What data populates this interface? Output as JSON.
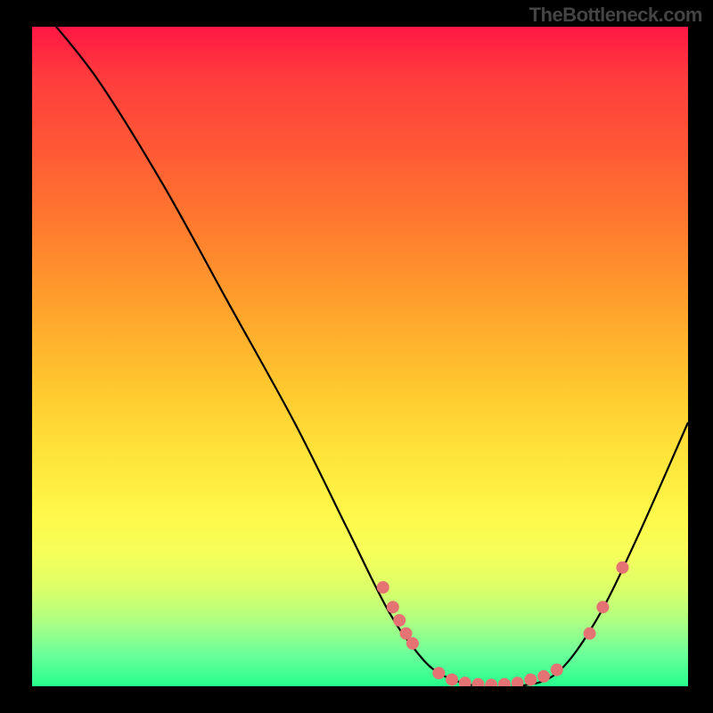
{
  "watermark": "TheBottleneck.com",
  "chart_data": {
    "type": "line",
    "title": "",
    "xlabel": "",
    "ylabel": "",
    "xlim": [
      0,
      100
    ],
    "ylim": [
      0,
      100
    ],
    "gradient_stops": [
      {
        "offset": 0,
        "color": "#ff1744"
      },
      {
        "offset": 8,
        "color": "#ff3d3d"
      },
      {
        "offset": 18,
        "color": "#ff5736"
      },
      {
        "offset": 30,
        "color": "#ff7a2e"
      },
      {
        "offset": 42,
        "color": "#ffa02c"
      },
      {
        "offset": 54,
        "color": "#ffc62e"
      },
      {
        "offset": 65,
        "color": "#ffe43a"
      },
      {
        "offset": 74,
        "color": "#fff84a"
      },
      {
        "offset": 80,
        "color": "#f6ff5a"
      },
      {
        "offset": 85,
        "color": "#dcff68"
      },
      {
        "offset": 90,
        "color": "#b0ff82"
      },
      {
        "offset": 95,
        "color": "#6eff9a"
      },
      {
        "offset": 100,
        "color": "#26ff8c"
      }
    ],
    "curve_points": [
      {
        "x": 2,
        "y": 102
      },
      {
        "x": 10,
        "y": 92
      },
      {
        "x": 20,
        "y": 76
      },
      {
        "x": 30,
        "y": 58
      },
      {
        "x": 40,
        "y": 40
      },
      {
        "x": 48,
        "y": 24
      },
      {
        "x": 54,
        "y": 12
      },
      {
        "x": 58,
        "y": 6
      },
      {
        "x": 62,
        "y": 2
      },
      {
        "x": 68,
        "y": 0
      },
      {
        "x": 74,
        "y": 0
      },
      {
        "x": 80,
        "y": 2
      },
      {
        "x": 86,
        "y": 10
      },
      {
        "x": 92,
        "y": 22
      },
      {
        "x": 100,
        "y": 40
      }
    ],
    "data_points": [
      {
        "x": 53.5,
        "y": 15
      },
      {
        "x": 55,
        "y": 12
      },
      {
        "x": 56,
        "y": 10
      },
      {
        "x": 57,
        "y": 8
      },
      {
        "x": 58,
        "y": 6.5
      },
      {
        "x": 62,
        "y": 2
      },
      {
        "x": 64,
        "y": 1
      },
      {
        "x": 66,
        "y": 0.5
      },
      {
        "x": 68,
        "y": 0.3
      },
      {
        "x": 70,
        "y": 0.2
      },
      {
        "x": 72,
        "y": 0.3
      },
      {
        "x": 74,
        "y": 0.5
      },
      {
        "x": 76,
        "y": 1
      },
      {
        "x": 78,
        "y": 1.5
      },
      {
        "x": 80,
        "y": 2.5
      },
      {
        "x": 85,
        "y": 8
      },
      {
        "x": 87,
        "y": 12
      },
      {
        "x": 90,
        "y": 18
      }
    ],
    "point_color": "#e57373",
    "curve_color": "#000000"
  }
}
